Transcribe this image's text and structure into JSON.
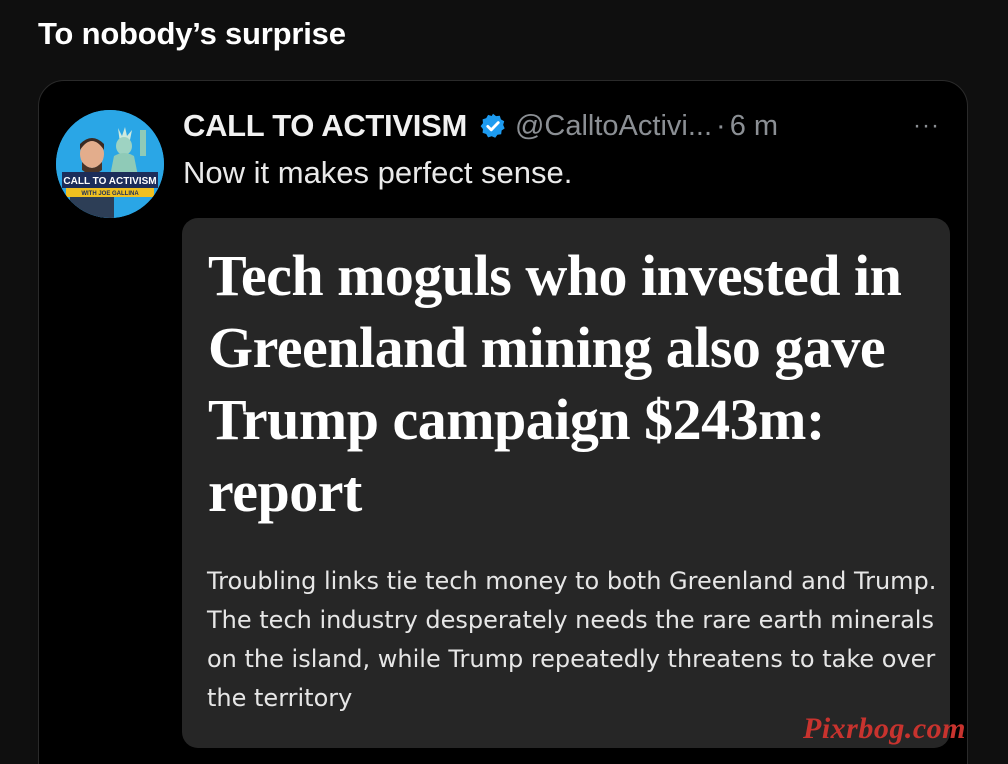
{
  "post": {
    "caption": "To nobody’s surprise"
  },
  "quoted_tweet": {
    "author_name": "CALL TO ACTIVISM",
    "handle": "@CalltoActivi...",
    "separator": "·",
    "timestamp": "6 m",
    "more_label": "···",
    "text": "Now it makes perfect sense.",
    "avatar": {
      "line1": "CALL TO ACTIVISM",
      "line2": "WITH JOE GALLINA"
    },
    "article": {
      "headline": "Tech moguls who invested in Greenland mining also gave Trump campaign $243m: report",
      "summary": "Troubling links tie tech money to both Greenland and Trump. The tech industry desperately needs the rare earth minerals on the island, while Trump repeatedly threatens to take over the territory"
    }
  },
  "watermark": "Pixrbog.com",
  "colors": {
    "background": "#0f0f0f",
    "card_background": "#262626",
    "muted_text": "#8b8f94",
    "verified_badge": "#1d9bf0",
    "watermark": "#c8332e"
  },
  "icons": {
    "verified": "verified-badge-icon",
    "more": "more-options-icon"
  }
}
